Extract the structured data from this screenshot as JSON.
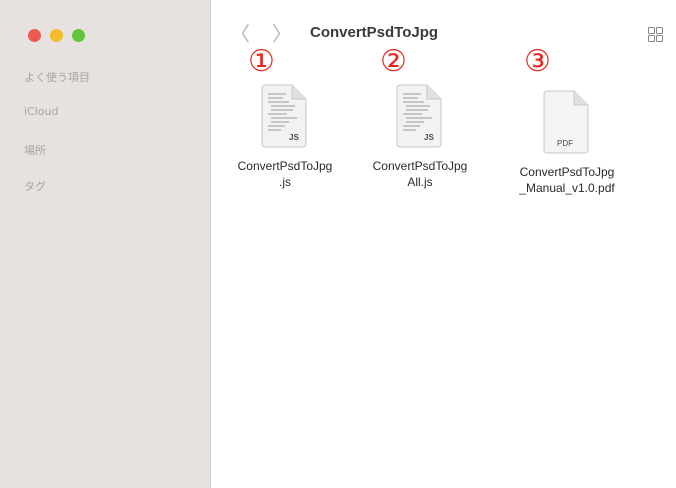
{
  "sidebar": {
    "items": [
      {
        "label": "よく使う項目"
      },
      {
        "label": "iCloud"
      },
      {
        "label": "場所"
      },
      {
        "label": "タグ"
      }
    ]
  },
  "toolbar": {
    "back_icon": "chevron-left-icon",
    "forward_icon": "chevron-right-icon",
    "back_glyph": "〈",
    "forward_glyph": "〉",
    "title": "ConvertPsdToJpg",
    "view_icon": "grid-view-icon"
  },
  "files": [
    {
      "marker": "①",
      "name": "ConvertPsdToJpg\n.js",
      "badge": "JS",
      "type": "js"
    },
    {
      "marker": "②",
      "name": "ConvertPsdToJpg\nAll.js",
      "badge": "JS",
      "type": "js"
    },
    {
      "marker": "③",
      "name": "ConvertPsdToJpg\n_Manual_v1.0.pdf",
      "badge": "PDF",
      "type": "pdf"
    }
  ],
  "colors": {
    "sidebar_bg": "#e6e2e0",
    "marker": "#e8261d",
    "close": "#ee5a52",
    "minimize": "#f4bb2c",
    "zoom": "#5fc63d"
  }
}
